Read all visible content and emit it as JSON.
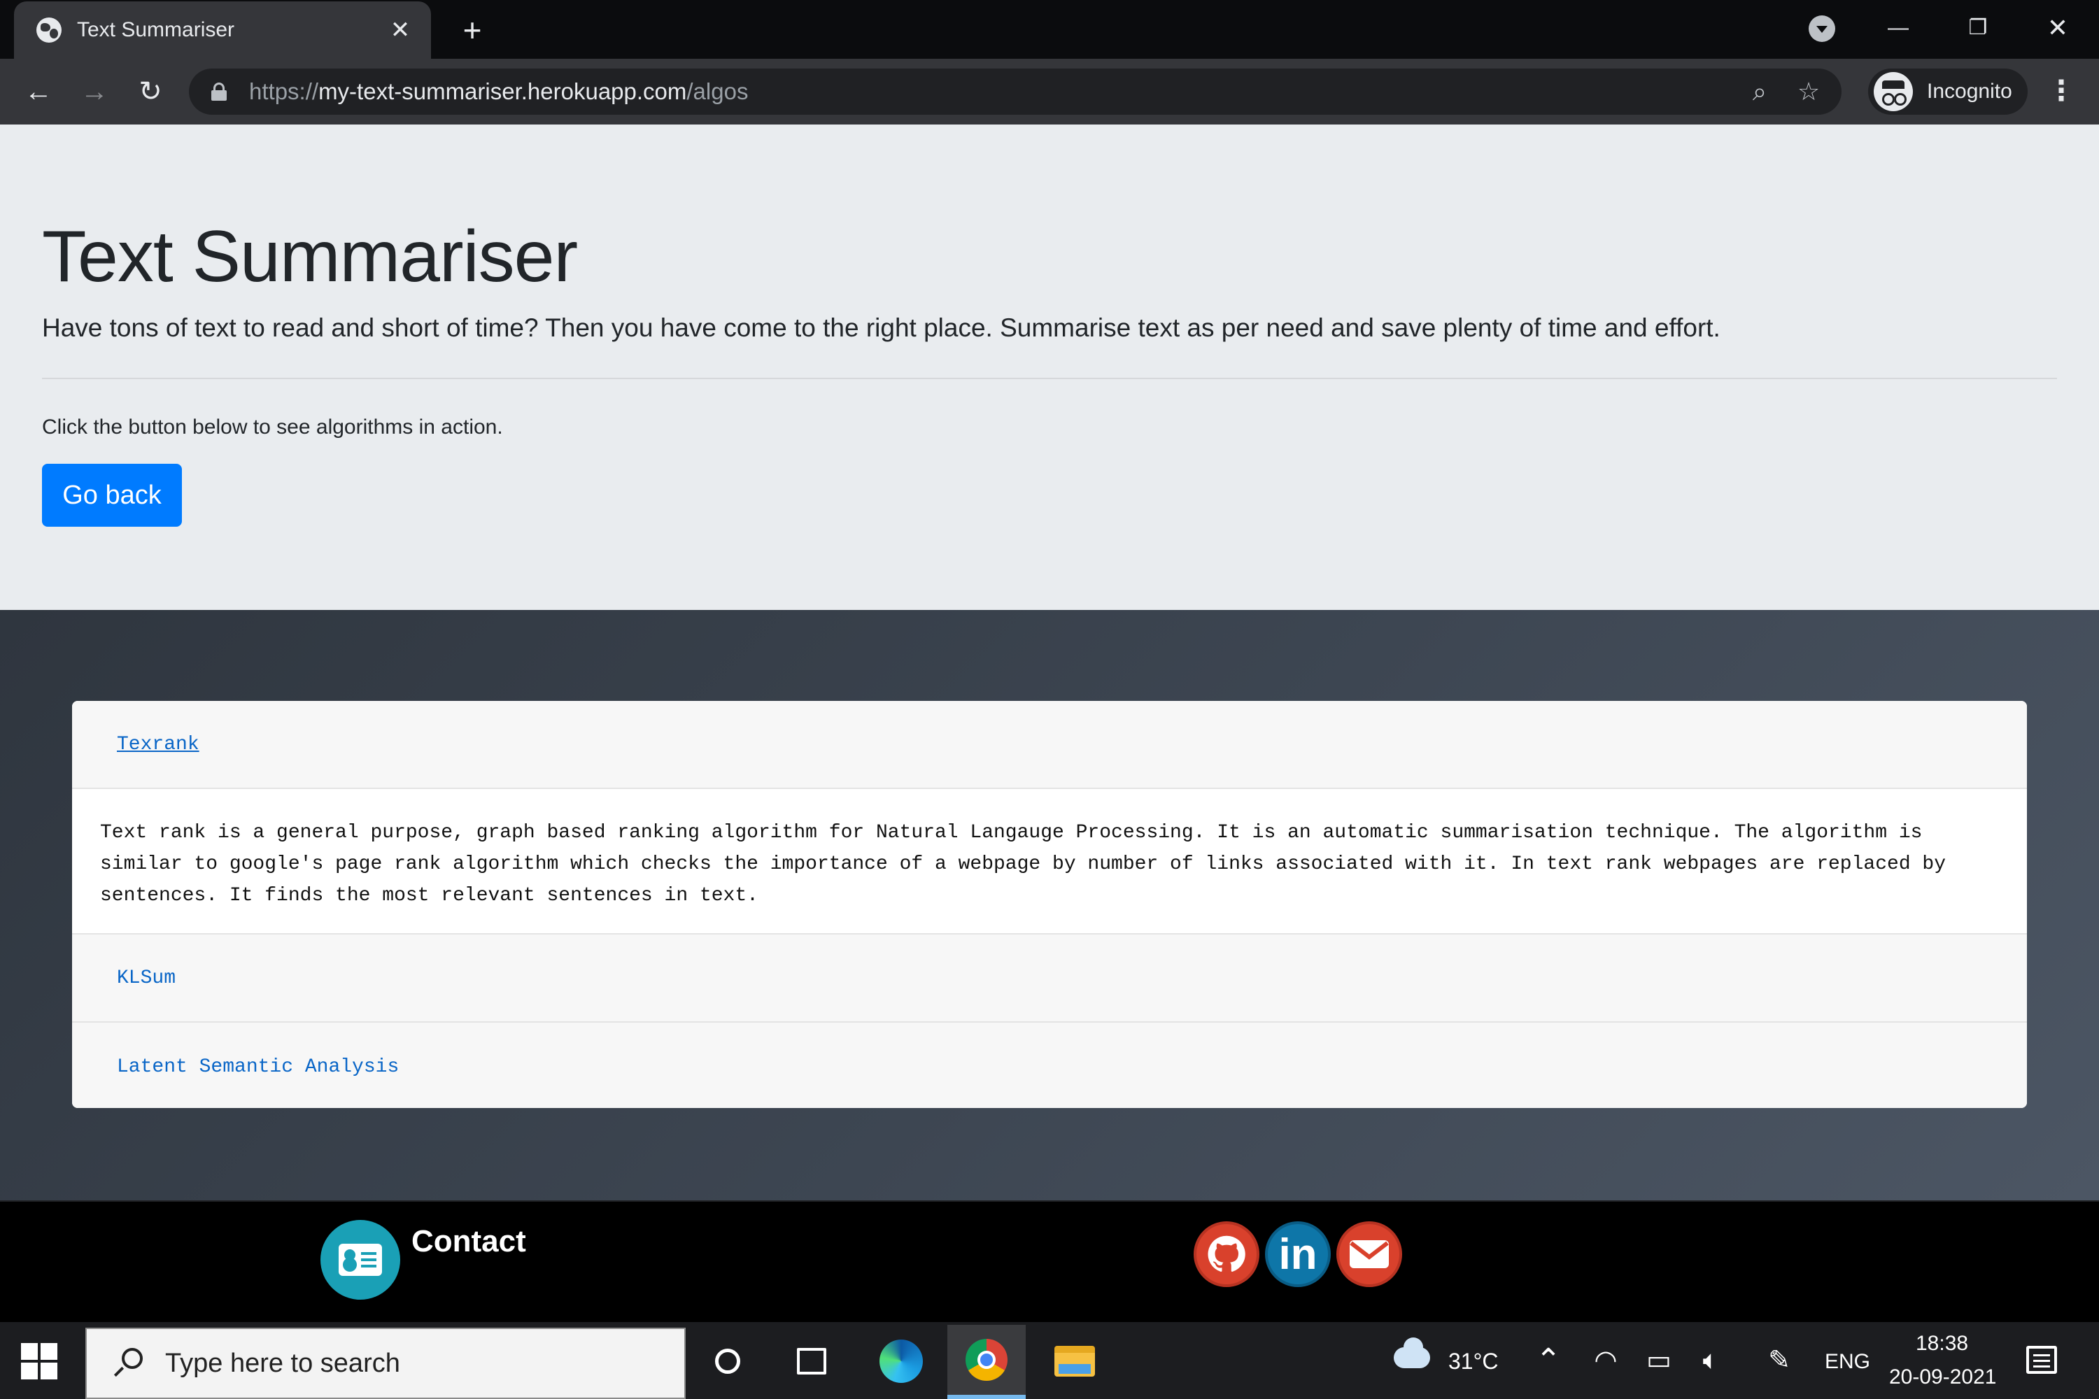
{
  "browser": {
    "tab_title": "Text Summariser",
    "tab_close": "✕",
    "new_tab": "+",
    "url_scheme": "https://",
    "url_host": "my-text-summariser.herokuapp.com",
    "url_path": "/algos",
    "profile_label": "Incognito",
    "back_icon": "←",
    "forward_icon": "→",
    "reload_icon": "↻",
    "zoom_icon": "⌕",
    "star_icon": "☆",
    "menu_icon": "⋮",
    "minimize": "—",
    "restore": "❐",
    "close": "✕"
  },
  "jumbotron": {
    "title": "Text Summariser",
    "lead": "Have tons of text to read and short of time? Then you have come to the right place. Summarise text as per need and save plenty of time and effort.",
    "hint": "Click the button below to see algorithms in action.",
    "button_label": "Go back"
  },
  "algorithms": [
    {
      "name": "Texrank",
      "expanded": true,
      "description": "Text rank is a general purpose, graph based ranking algorithm for Natural Langauge Processing. It is an automatic summarisation technique. The algorithm is similar to google's page rank algorithm which checks the importance of a webpage by number of links associated with it. In text rank webpages are replaced by sentences. It finds the most relevant sentences in text."
    },
    {
      "name": "KLSum",
      "expanded": false
    },
    {
      "name": "Latent Semantic Analysis",
      "expanded": false
    }
  ],
  "footer": {
    "contact_label": "Contact",
    "social": [
      {
        "name": "github",
        "icon": "github-icon",
        "color": "#d9412c"
      },
      {
        "name": "linkedin",
        "icon": "linkedin-icon",
        "label": "in",
        "color": "#0e76a8"
      },
      {
        "name": "email",
        "icon": "envelope-icon",
        "color": "#d9412c"
      }
    ]
  },
  "taskbar": {
    "search_placeholder": "Type here to search",
    "weather": "31°C",
    "language": "ENG",
    "time": "18:38",
    "date": "20-09-2021"
  },
  "colors": {
    "primary_button": "#007bff",
    "link": "#0a66c7",
    "jumbotron_bg": "#e9ecef"
  }
}
